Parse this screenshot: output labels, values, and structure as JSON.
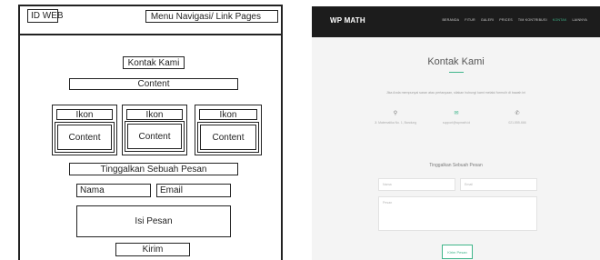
{
  "wireframe": {
    "id_web": "ID WEB",
    "menu": "Menu Navigasi/ Link Pages",
    "title": "Kontak Kami",
    "content": "Content",
    "columns": [
      {
        "icon": "Ikon",
        "content": "Content"
      },
      {
        "icon": "Ikon",
        "content": "Content"
      },
      {
        "icon": "Ikon",
        "content": "Content"
      }
    ],
    "leave_message": "Tinggalkan Sebuah Pesan",
    "name": "Nama",
    "email": "Email",
    "message": "Isi Pesan",
    "send": "Kirim"
  },
  "mockup": {
    "brand": "WP MATH",
    "nav": [
      "BERANDA",
      "FITUR",
      "GALERI",
      "PRICES",
      "TIM KONTRIBUSI",
      "KONTAK",
      "LAINNYA"
    ],
    "active_nav_index": 5,
    "title": "Kontak Kami",
    "lead": "Jika Anda mempunyai saran atau pertanyaan, silakan hubungi kami melalui formulir di bawah ini",
    "info": [
      {
        "icon": "location-icon",
        "glyph": "⚲",
        "text": "Jl. Matematika No. 1, Bandung"
      },
      {
        "icon": "email-icon",
        "glyph": "✉",
        "text": "support@wpmath.id"
      },
      {
        "icon": "phone-icon",
        "glyph": "✆",
        "text": "021-555-666"
      }
    ],
    "subtitle": "Tinggalkan Sebuah Pesan",
    "name_placeholder": "Nama",
    "email_placeholder": "Email",
    "message_placeholder": "Pesan",
    "send": "Kirim Pesan",
    "accent_color": "#3fb58a",
    "navbar_color": "#1c1c1c"
  }
}
